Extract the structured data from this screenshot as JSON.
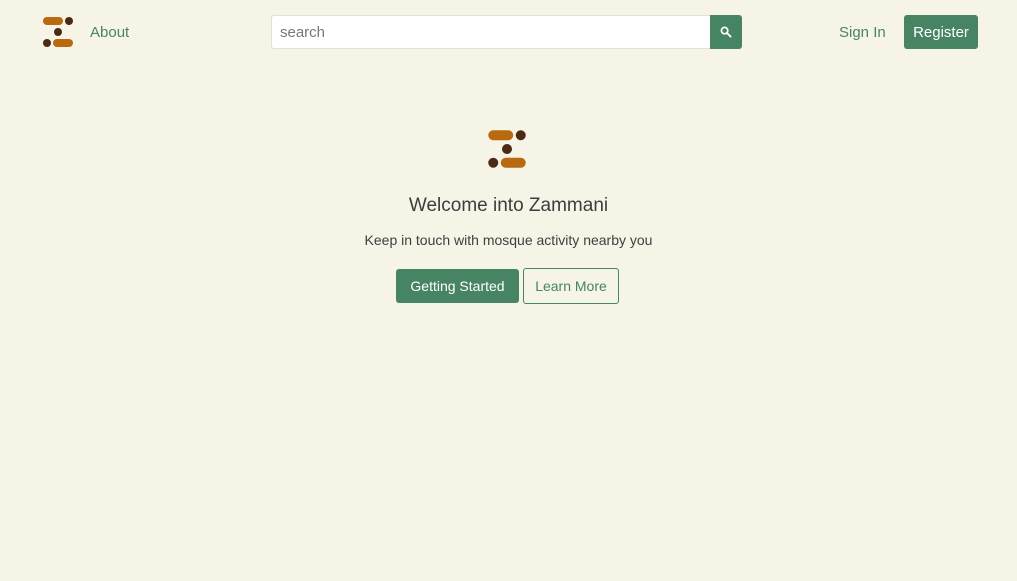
{
  "nav": {
    "logo_icon": "zammani-logo-icon",
    "about_label": "About",
    "search": {
      "value": "",
      "placeholder": "search",
      "button_icon": "search-icon"
    },
    "signin_label": "Sign In",
    "register_label": "Register"
  },
  "hero": {
    "logo_icon": "zammani-logo-icon",
    "title": "Welcome into Zammani",
    "subtitle": "Keep in touch with mosque activity nearby you",
    "primary_button_label": "Getting Started",
    "secondary_button_label": "Learn More"
  },
  "colors": {
    "background": "#f6f3e7",
    "accent_green": "#468463",
    "logo_orange": "#b9690f",
    "logo_brown": "#4a2a12"
  }
}
